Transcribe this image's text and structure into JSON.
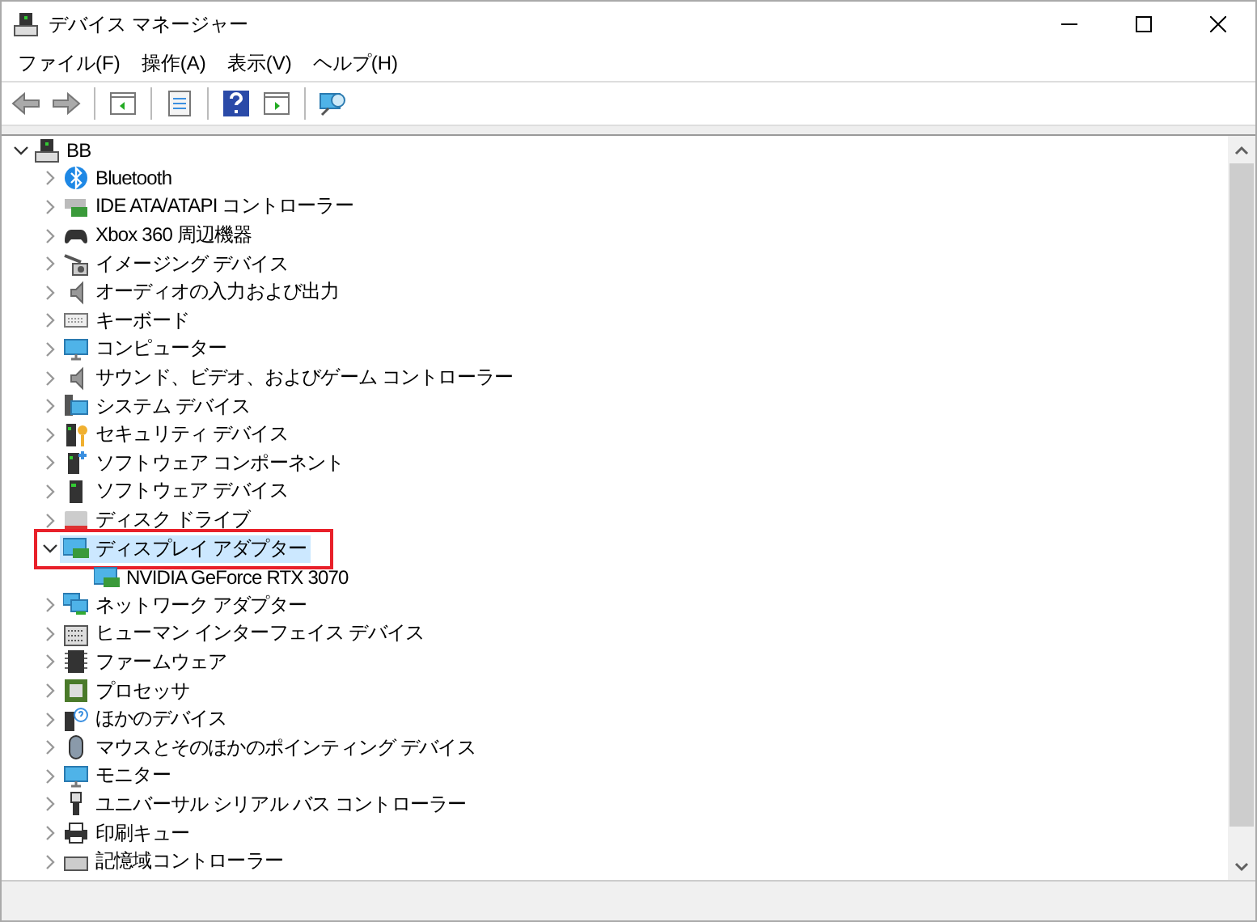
{
  "window": {
    "title": "デバイス マネージャー"
  },
  "menu": [
    "ファイル(F)",
    "操作(A)",
    "表示(V)",
    "ヘルプ(H)"
  ],
  "tree": {
    "label": "BB",
    "expanded": true,
    "selected": false,
    "children": [
      {
        "label": "Bluetooth",
        "expanded": false,
        "selected": false
      },
      {
        "label": "IDE ATA/ATAPI コントローラー",
        "expanded": false,
        "selected": false
      },
      {
        "label": "Xbox 360 周辺機器",
        "expanded": false,
        "selected": false
      },
      {
        "label": "イメージング デバイス",
        "expanded": false,
        "selected": false
      },
      {
        "label": "オーディオの入力および出力",
        "expanded": false,
        "selected": false
      },
      {
        "label": "キーボード",
        "expanded": false,
        "selected": false
      },
      {
        "label": "コンピューター",
        "expanded": false,
        "selected": false
      },
      {
        "label": "サウンド、ビデオ、およびゲーム コントローラー",
        "expanded": false,
        "selected": false
      },
      {
        "label": "システム デバイス",
        "expanded": false,
        "selected": false
      },
      {
        "label": "セキュリティ デバイス",
        "expanded": false,
        "selected": false
      },
      {
        "label": "ソフトウェア コンポーネント",
        "expanded": false,
        "selected": false
      },
      {
        "label": "ソフトウェア デバイス",
        "expanded": false,
        "selected": false
      },
      {
        "label": "ディスク ドライブ",
        "expanded": false,
        "selected": false
      },
      {
        "label": "ディスプレイ アダプター",
        "expanded": true,
        "selected": true,
        "highlight_box": true,
        "children": [
          {
            "label": "NVIDIA GeForce RTX 3070",
            "selected": false
          }
        ]
      },
      {
        "label": "ネットワーク アダプター",
        "expanded": false,
        "selected": false
      },
      {
        "label": "ヒューマン インターフェイス デバイス",
        "expanded": false,
        "selected": false
      },
      {
        "label": "ファームウェア",
        "expanded": false,
        "selected": false
      },
      {
        "label": "プロセッサ",
        "expanded": false,
        "selected": false
      },
      {
        "label": "ほかのデバイス",
        "expanded": false,
        "selected": false
      },
      {
        "label": "マウスとそのほかのポインティング デバイス",
        "expanded": false,
        "selected": false
      },
      {
        "label": "モニター",
        "expanded": false,
        "selected": false
      },
      {
        "label": "ユニバーサル シリアル バス コントローラー",
        "expanded": false,
        "selected": false
      },
      {
        "label": "印刷キュー",
        "expanded": false,
        "selected": false
      },
      {
        "label": "記憶域コントローラー",
        "expanded": false,
        "selected": false
      }
    ]
  }
}
